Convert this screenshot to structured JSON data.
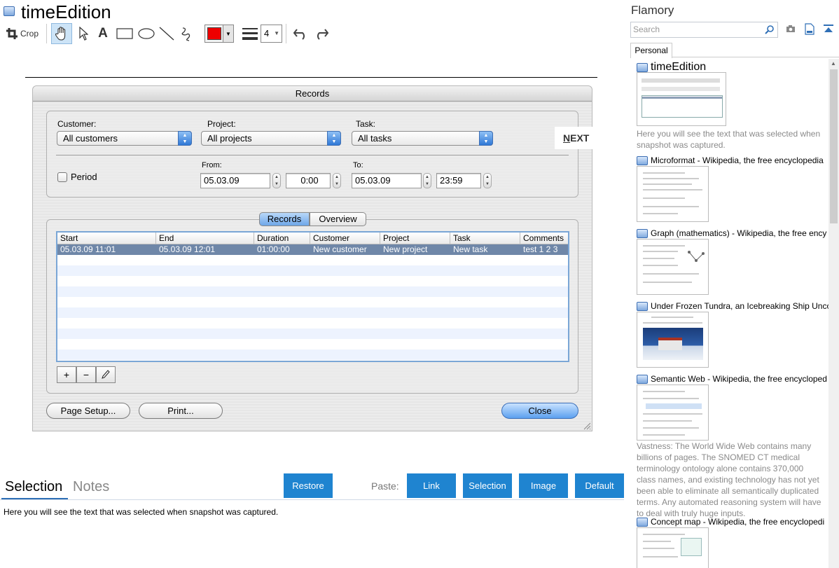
{
  "app": {
    "title": "timeEdition"
  },
  "toolbar": {
    "crop_label": "Crop",
    "line_width_value": "4",
    "color": "#ee0000"
  },
  "records_window": {
    "title": "Records",
    "customer_label": "Customer:",
    "customer_value": "All customers",
    "project_label": "Project:",
    "project_value": "All projects",
    "task_label": "Task:",
    "task_value": "All tasks",
    "period_label": "Period",
    "from_label": "From:",
    "from_date": "05.03.09",
    "from_time": "0:00",
    "to_label": "To:",
    "to_date": "05.03.09",
    "to_time": "23:59",
    "next_label": "NEXT",
    "tabs": [
      "Records",
      "Overview"
    ],
    "columns": [
      "Start",
      "End",
      "Duration",
      "Customer",
      "Project",
      "Task",
      "Comments"
    ],
    "rows": [
      [
        "05.03.09 11:01",
        "05.03.09 12:01",
        "01:00:00",
        "New customer",
        "New project",
        "New task",
        "test 1 2 3"
      ]
    ],
    "add_label": "+",
    "remove_label": "−",
    "page_setup_label": "Page Setup...",
    "print_label": "Print...",
    "close_label": "Close"
  },
  "bottom": {
    "tab_selection": "Selection",
    "tab_notes": "Notes",
    "restore_label": "Restore",
    "paste_label": "Paste:",
    "paste_buttons": [
      "Link",
      "Selection",
      "Image",
      "Default"
    ],
    "selection_text": "Here you will see the text that was selected when snapshot was captured."
  },
  "flamory": {
    "title": "Flamory",
    "search_placeholder": "Search",
    "tab_personal": "Personal",
    "items": [
      {
        "title": "timeEdition",
        "desc": "Here you will see the text that was selected when snapshot was captured."
      },
      {
        "title": "Microformat - Wikipedia, the free encyclopedia",
        "desc": ""
      },
      {
        "title": "Graph (mathematics) - Wikipedia, the free ency",
        "desc": ""
      },
      {
        "title": "Under Frozen Tundra, an Icebreaking Ship Unco",
        "desc": ""
      },
      {
        "title": "Semantic Web - Wikipedia, the free encycloped",
        "desc": "Vastness: The World Wide Web contains many billions of pages. The SNOMED CT medical terminology ontology alone contains 370,000 class names, and existing technology has not yet been able to eliminate all semantically duplicated terms. Any automated reasoning system will have to deal with truly huge inputs."
      },
      {
        "title": "Concept map - Wikipedia, the free encyclopedi",
        "desc": ""
      }
    ]
  }
}
